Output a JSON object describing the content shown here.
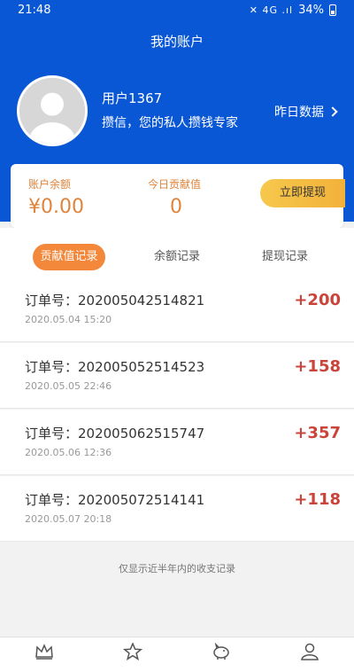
{
  "status": {
    "time": "21:48",
    "icons": "✕ 4G .ıl",
    "battery": "34%"
  },
  "page_title": "我的账户",
  "profile": {
    "username": "用户1367",
    "slogan": "攒信，您的私人攒钱专家",
    "yesterday_label": "昨日数据"
  },
  "summary": {
    "balance_label": "账户余额",
    "balance_value": "¥0.00",
    "contribution_label": "今日贡献值",
    "contribution_value": "0",
    "withdraw_label": "立即提现"
  },
  "tabs": [
    {
      "label": "贡献值记录",
      "active": true
    },
    {
      "label": "余额记录",
      "active": false
    },
    {
      "label": "提现记录",
      "active": false
    }
  ],
  "records": [
    {
      "order": "订单号：202005042514821",
      "date": "2020.05.04 15:20",
      "amount": "+200"
    },
    {
      "order": "订单号：202005052514523",
      "date": "2020.05.05 22:46",
      "amount": "+158"
    },
    {
      "order": "订单号：202005062515747",
      "date": "2020.05.06 12:36",
      "amount": "+357"
    },
    {
      "order": "订单号：202005072514141",
      "date": "2020.05.07 20:18",
      "amount": "+118"
    }
  ],
  "note": "仅显示近半年内的收支记录",
  "bottom_nav": [
    {
      "label": "",
      "icon": "crown-icon"
    },
    {
      "label": "",
      "icon": "star-icon"
    },
    {
      "label": "",
      "icon": "piggy-bank-icon"
    },
    {
      "label": "",
      "icon": "user-icon"
    }
  ],
  "colors": {
    "header": "#0a57d6",
    "accent_orange": "#f3873a",
    "amount_red": "#c9443a",
    "withdraw_yellow": "#f6c84c"
  }
}
